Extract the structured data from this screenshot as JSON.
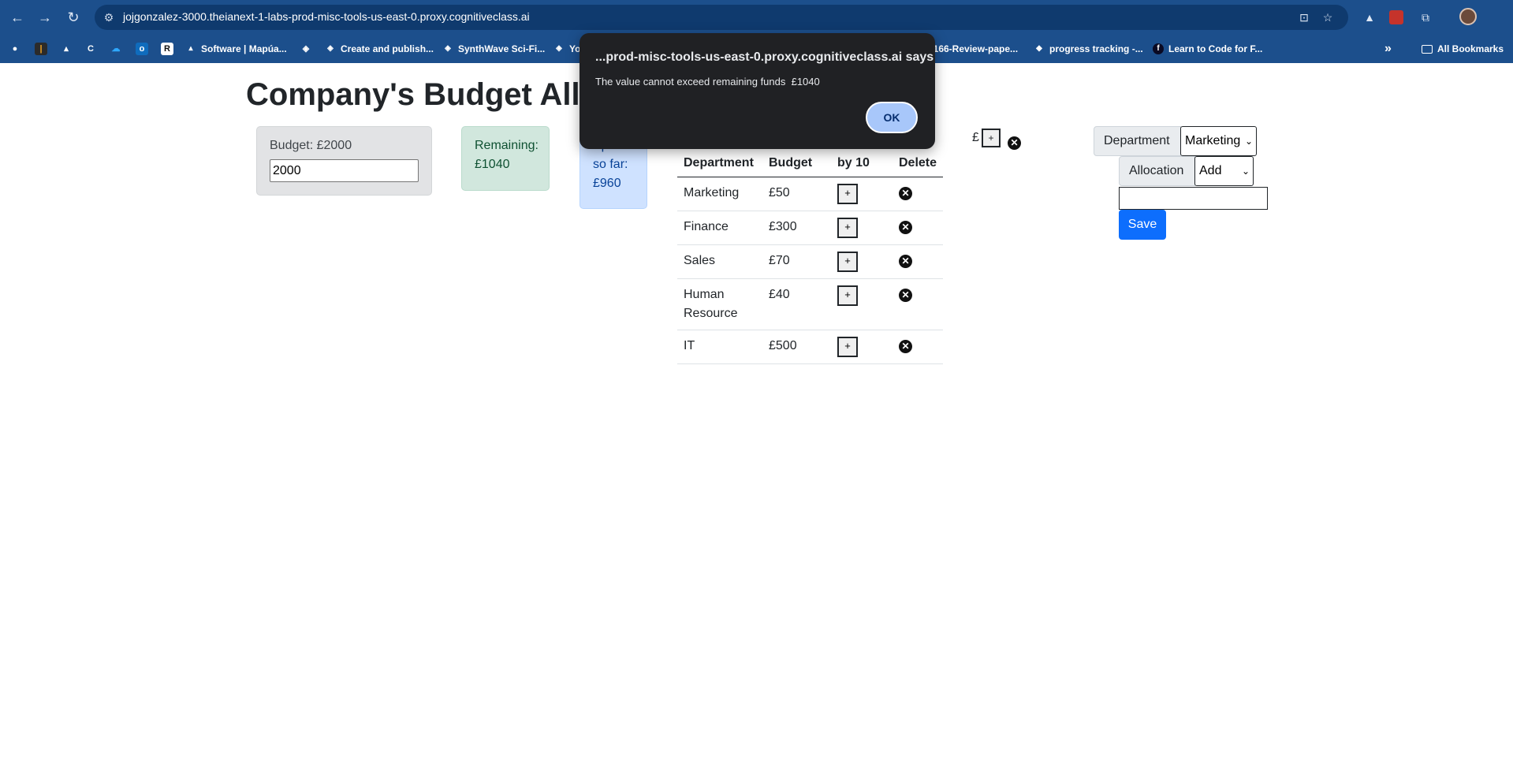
{
  "browser": {
    "url": "jojgonzalez-3000.theianext-1-labs-prod-misc-tools-us-east-0.proxy.cognitiveclass.ai",
    "bookmarks": [
      {
        "label": "Software | Mapúa..."
      },
      {
        "label": "Create and publish..."
      },
      {
        "label": "SynthWave Sci-Fi..."
      },
      {
        "label": "Yo"
      },
      {
        "label": "IT166-Review-pape..."
      },
      {
        "label": "progress tracking -..."
      },
      {
        "label": "Learn to Code for F..."
      }
    ],
    "more_label": "»",
    "all_bookmarks_label": "All Bookmarks"
  },
  "page": {
    "title": "Company's Budget Allo",
    "budget_card": {
      "label": "Budget: £2000",
      "value": "2000"
    },
    "remaining_card": {
      "line1": "Remaining:",
      "line2": "£1040"
    },
    "spent_card": {
      "line1": "Spent",
      "line2": "so far:",
      "line3": "£960"
    },
    "table": {
      "headers": [
        "Department",
        "Budget",
        "by 10",
        "Delete"
      ],
      "rows": [
        {
          "department": "Marketing",
          "budget": "£50"
        },
        {
          "department": "Finance",
          "budget": "£300"
        },
        {
          "department": "Sales",
          "budget": "£70"
        },
        {
          "department": "Human Resource",
          "budget": "£40"
        },
        {
          "department": "IT",
          "budget": "£500"
        }
      ],
      "plus_label": "+",
      "delete_symbol": "✕"
    },
    "stray": {
      "currency": "£",
      "plus": "+"
    },
    "form": {
      "department_label": "Department",
      "department_value": "Marketing",
      "allocation_label": "Allocation",
      "allocation_value": "Add",
      "amount_value": "",
      "save_label": "Save"
    }
  },
  "dialog": {
    "title": "...prod-misc-tools-us-east-0.proxy.cognitiveclass.ai says",
    "message": "The value cannot exceed remaining funds  £1040",
    "ok_label": "OK"
  }
}
